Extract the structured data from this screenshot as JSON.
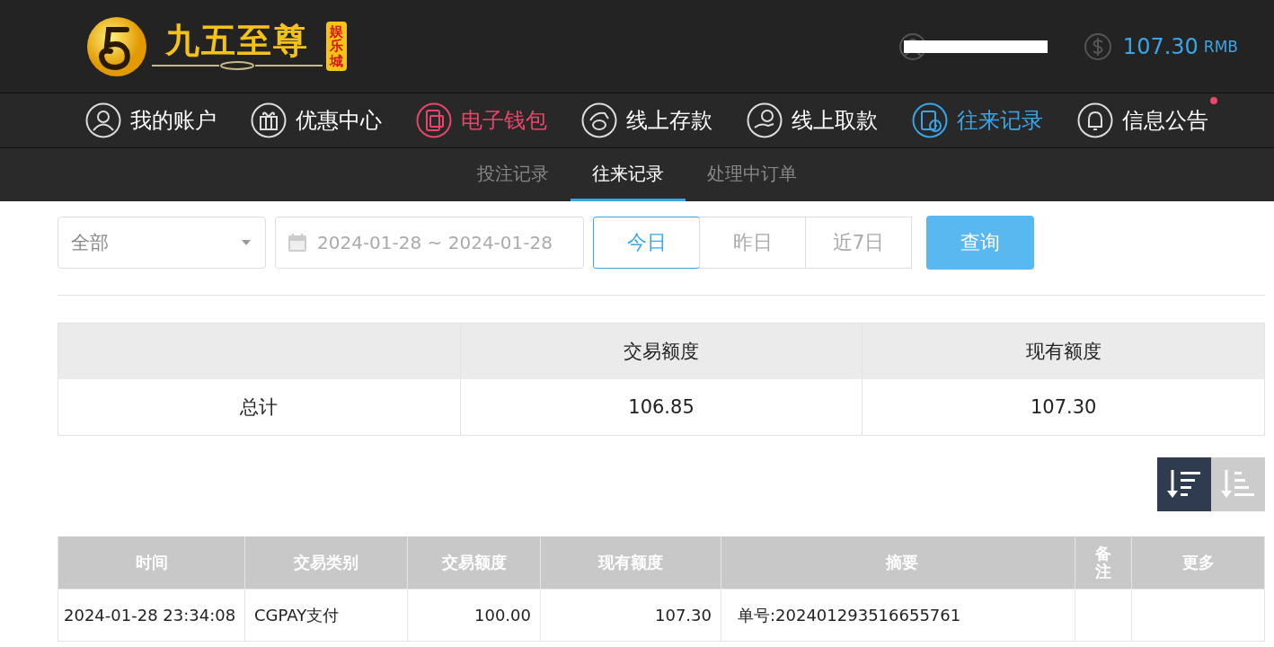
{
  "header": {
    "logo": {
      "name": "九五至尊",
      "badge": "娱乐城"
    },
    "username_redacted": true,
    "balance": "107.30",
    "currency": "RMB"
  },
  "nav": [
    {
      "label": "我的账户",
      "selected": false,
      "featured": false,
      "unread": false
    },
    {
      "label": "优惠中心",
      "selected": false,
      "featured": false,
      "unread": false
    },
    {
      "label": "电子钱包",
      "selected": false,
      "featured": true,
      "unread": false
    },
    {
      "label": "线上存款",
      "selected": false,
      "featured": false,
      "unread": false
    },
    {
      "label": "线上取款",
      "selected": false,
      "featured": false,
      "unread": false
    },
    {
      "label": "往来记录",
      "selected": true,
      "featured": false,
      "unread": false
    },
    {
      "label": "信息公告",
      "selected": false,
      "featured": false,
      "unread": true
    }
  ],
  "subtabs": [
    {
      "label": "投注记录",
      "selected": false
    },
    {
      "label": "往来记录",
      "selected": true
    },
    {
      "label": "处理中订单",
      "selected": false
    }
  ],
  "filters": {
    "type_select": "全部",
    "date_range": "2024-01-28 ~ 2024-01-28",
    "quick_ranges": [
      {
        "label": "今日",
        "selected": true
      },
      {
        "label": "昨日",
        "selected": false
      },
      {
        "label": "近7日",
        "selected": false
      }
    ],
    "query_button": "查询"
  },
  "summary": {
    "columns": [
      "交易额度",
      "现有额度"
    ],
    "row": {
      "label": "总计",
      "values": [
        "106.85",
        "107.30"
      ]
    }
  },
  "sort_buttons": [
    {
      "kind": "desc",
      "selected": true
    },
    {
      "kind": "asc",
      "selected": false
    }
  ],
  "table": {
    "columns": [
      "时间",
      "交易类别",
      "交易额度",
      "现有额度",
      "摘要",
      "备注",
      "更多"
    ],
    "rows": [
      [
        "2024-01-28 23:34:08",
        "CGPAY支付",
        "100.00",
        "107.30",
        "单号:202401293516655761",
        "",
        ""
      ]
    ]
  }
}
